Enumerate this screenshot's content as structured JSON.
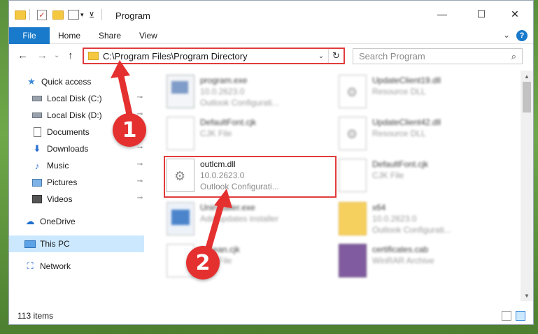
{
  "window": {
    "title": "Program",
    "controls": {
      "minimize": "—",
      "maximize": "☐",
      "close": "✕"
    }
  },
  "ribbon": {
    "tabs": [
      "File",
      "Home",
      "Share",
      "View"
    ],
    "expand_icon": "⌄",
    "help_icon": "?"
  },
  "nav": {
    "back": "←",
    "forward": "→",
    "recent": "⌄",
    "up": "↑",
    "address": "C:\\Program Files\\Program Directory",
    "address_dropdown": "⌄",
    "refresh": "↻",
    "search_placeholder": "Search Program",
    "search_icon": "⌕"
  },
  "sidebar": {
    "items": [
      {
        "label": "Quick access",
        "icon": "star-icon",
        "glyph": "★",
        "pinned": false
      },
      {
        "label": "Local Disk (C:)",
        "icon": "disk-icon",
        "pinned": true
      },
      {
        "label": "Local Disk (D:)",
        "icon": "disk-icon",
        "pinned": true
      },
      {
        "label": "Documents",
        "icon": "documents-icon",
        "pinned": true
      },
      {
        "label": "Downloads",
        "icon": "downloads-icon",
        "glyph": "⬇",
        "pinned": true
      },
      {
        "label": "Music",
        "icon": "music-icon",
        "glyph": "♪",
        "pinned": true
      },
      {
        "label": "Pictures",
        "icon": "pictures-icon",
        "pinned": true
      },
      {
        "label": "Videos",
        "icon": "videos-icon",
        "pinned": true
      },
      {
        "label": "OneDrive",
        "icon": "cloud-icon",
        "glyph": "☁",
        "pinned": false
      },
      {
        "label": "This PC",
        "icon": "pc-icon",
        "pinned": false,
        "selected": true
      },
      {
        "label": "Network",
        "icon": "network-icon",
        "glyph": "⛶",
        "pinned": false
      }
    ],
    "pin_glyph": "📌"
  },
  "files": [
    {
      "name": "program.exe",
      "line2": "10.0.2623.0",
      "line3": "Outlook Configurati...",
      "type": "exe",
      "blurred": true
    },
    {
      "name": "UpdateClient19.dll",
      "line2": "Resource DLL",
      "line3": "",
      "type": "dll",
      "blurred": true
    },
    {
      "name": "DefaultFont.cjk",
      "line2": "CJK File",
      "line3": "",
      "type": "doc",
      "blurred": true
    },
    {
      "name": "UpdateClient42.dll",
      "line2": "Resource DLL",
      "line3": "",
      "type": "dll",
      "blurred": true
    },
    {
      "name": "outlcm.dll",
      "line2": "10.0.2623.0",
      "line3": "Outlook Configurati...",
      "type": "dll",
      "blurred": false,
      "highlighted": true
    },
    {
      "name": "DefaultFont.cjk",
      "line2": "CJK File",
      "line3": "",
      "type": "doc",
      "blurred": true
    },
    {
      "name": "Uninstaller.exe",
      "line2": "Add updates installer",
      "line3": "",
      "type": "installer",
      "blurred": true
    },
    {
      "name": "x64",
      "line2": "10.0.2623.0",
      "line3": "Outlook Configurati...",
      "type": "folder",
      "blurred": true
    },
    {
      "name": "Korean.cjk",
      "line2": "CJK File",
      "line3": "",
      "type": "doc",
      "blurred": true
    },
    {
      "name": "certificates.cab",
      "line2": "WinRAR Archive",
      "line3": "",
      "type": "rar",
      "blurred": true
    }
  ],
  "status": {
    "item_count": "113 items"
  },
  "annotations": {
    "step1": "1",
    "step2": "2",
    "color": "#e53030"
  }
}
